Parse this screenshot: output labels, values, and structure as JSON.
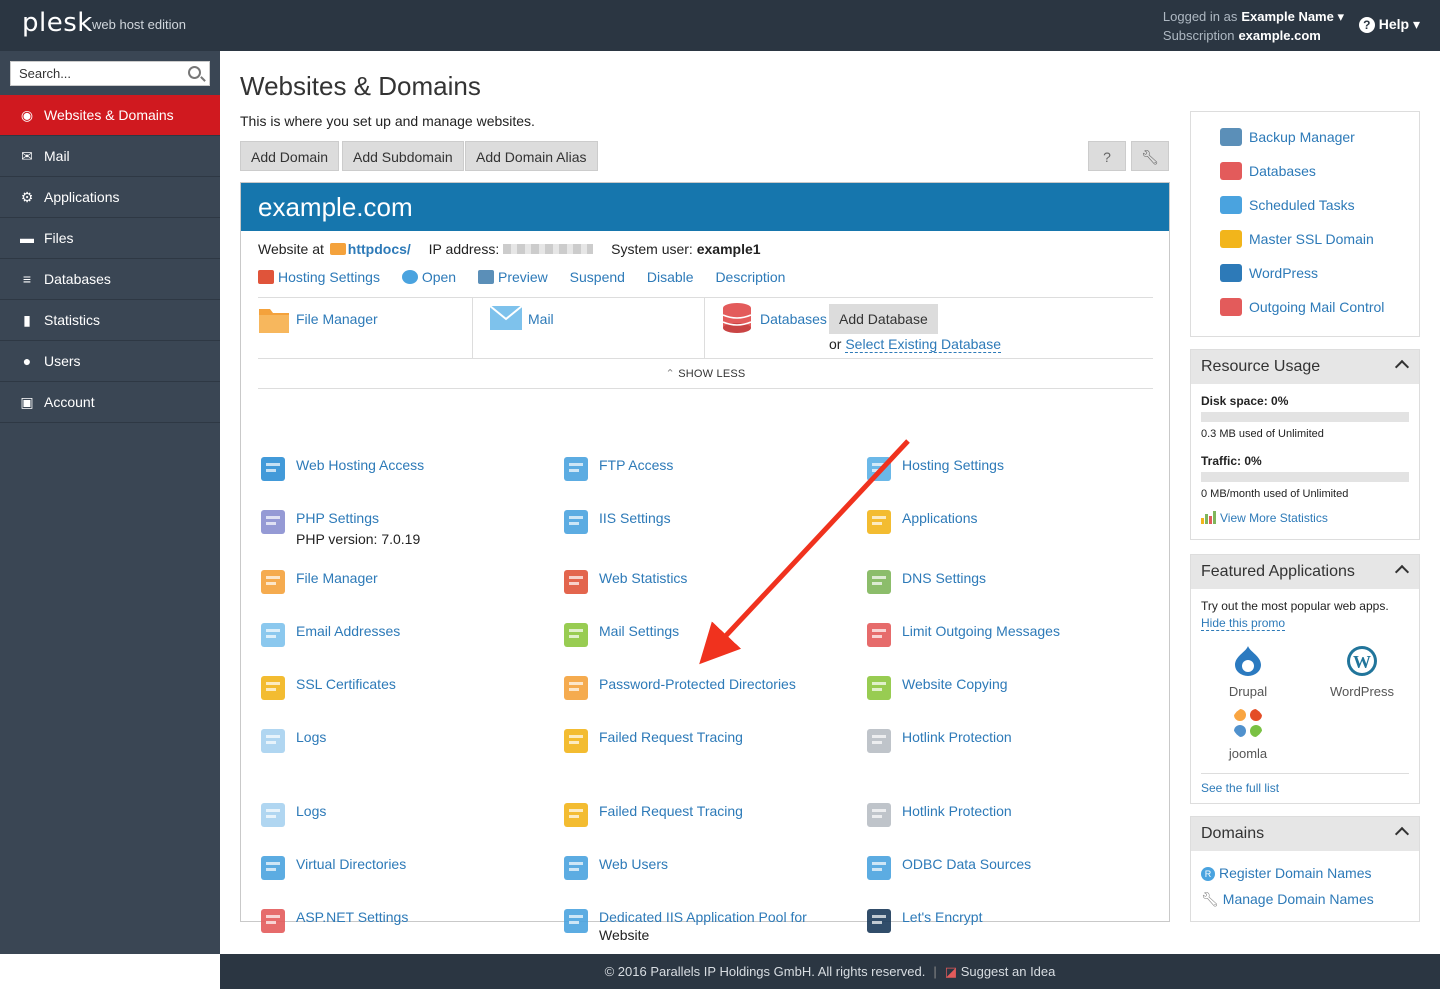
{
  "topbar": {
    "logo": "plesk",
    "edition": "web host edition",
    "logged_in_label": "Logged in as",
    "user_name": "Example Name",
    "subscription_label": "Subscription",
    "subscription_value": "example.com",
    "help": "Help"
  },
  "sidebar": {
    "search_placeholder": "Search...",
    "items": [
      {
        "label": "Websites & Domains",
        "icon": "globe-icon",
        "active": true
      },
      {
        "label": "Mail",
        "icon": "envelope-icon"
      },
      {
        "label": "Applications",
        "icon": "gear-icon"
      },
      {
        "label": "Files",
        "icon": "folder-icon"
      },
      {
        "label": "Databases",
        "icon": "database-icon"
      },
      {
        "label": "Statistics",
        "icon": "bar-chart-icon"
      },
      {
        "label": "Users",
        "icon": "user-icon"
      },
      {
        "label": "Account",
        "icon": "account-icon"
      }
    ]
  },
  "main": {
    "title": "Websites & Domains",
    "subtitle": "This is where you set up and manage websites.",
    "buttons": [
      "Add Domain",
      "Add Subdomain",
      "Add Domain Alias"
    ],
    "help_btn": "?",
    "domain": {
      "name": "example.com",
      "website_at_label": "Website at",
      "docroot": "httpdocs/",
      "ip_label": "IP address:",
      "system_user_label": "System user:",
      "system_user": "example1",
      "links": [
        "Hosting Settings",
        "Open",
        "Preview",
        "Suspend",
        "Disable",
        "Description"
      ],
      "quick": {
        "file_manager": "File Manager",
        "mail": "Mail",
        "databases": "Databases",
        "add_database": "Add Database",
        "or": "or",
        "select_existing": "Select Existing Database"
      },
      "show_less": "SHOW LESS",
      "grid": [
        {
          "label": "Web Hosting Access",
          "icon": "web-hosting-access-icon",
          "color": "#2d8fd5"
        },
        {
          "label": "FTP Access",
          "icon": "ftp-access-icon",
          "color": "#4aa3df"
        },
        {
          "label": "Hosting Settings",
          "icon": "hosting-settings-icon",
          "color": "#5bb0e6"
        },
        {
          "label": "PHP Settings",
          "icon": "php-icon",
          "color": "#8a8fd0",
          "sub": "PHP version: 7.0.19"
        },
        {
          "label": "IIS Settings",
          "icon": "iis-settings-icon",
          "color": "#4aa3df"
        },
        {
          "label": "Applications",
          "icon": "applications-gear-icon",
          "color": "#f2b51b"
        },
        {
          "label": "File Manager",
          "icon": "folder-icon",
          "color": "#f4a23c"
        },
        {
          "label": "Web Statistics",
          "icon": "web-statistics-icon",
          "color": "#e0543a"
        },
        {
          "label": "DNS Settings",
          "icon": "dns-settings-icon",
          "color": "#7fb65b"
        },
        {
          "label": "Email Addresses",
          "icon": "envelope-icon",
          "color": "#7ec2ec"
        },
        {
          "label": "Mail Settings",
          "icon": "mail-settings-icon",
          "color": "#8dc63f"
        },
        {
          "label": "Limit Outgoing Messages",
          "icon": "limit-mail-icon",
          "color": "#e35b5b"
        },
        {
          "label": "SSL Certificates",
          "icon": "ssl-certificate-icon",
          "color": "#f2b51b"
        },
        {
          "label": "Password-Protected Directories",
          "icon": "protected-folder-icon",
          "color": "#f4a23c"
        },
        {
          "label": "Website Copying",
          "icon": "website-copying-icon",
          "color": "#8dc63f"
        },
        {
          "label": "Logs",
          "icon": "logs-icon",
          "color": "#a7d2f0"
        },
        {
          "label": "Failed Request Tracing",
          "icon": "failed-request-tracing-icon",
          "color": "#f2b51b"
        },
        {
          "label": "Hotlink Protection",
          "icon": "hotlink-protection-icon",
          "color": "#b8bec4"
        },
        {
          "label": "Logs",
          "icon": "logs-icon",
          "color": "#a7d2f0"
        },
        {
          "label": "Failed Request Tracing",
          "icon": "failed-request-tracing-icon",
          "color": "#f2b51b"
        },
        {
          "label": "Hotlink Protection",
          "icon": "hotlink-protection-icon",
          "color": "#b8bec4"
        },
        {
          "label": "Virtual Directories",
          "icon": "virtual-directories-icon",
          "color": "#4aa3df"
        },
        {
          "label": "Web Users",
          "icon": "web-users-icon",
          "color": "#4aa3df"
        },
        {
          "label": "ODBC Data Sources",
          "icon": "odbc-icon",
          "color": "#4aa3df"
        },
        {
          "label": "ASP.NET Settings",
          "icon": "aspnet-icon",
          "color": "#e35b5b"
        },
        {
          "label": "Dedicated IIS Application Pool for",
          "label2": "Website",
          "icon": "app-pool-icon",
          "color": "#4aa3df"
        },
        {
          "label": "Let's Encrypt",
          "icon": "lets-encrypt-icon",
          "color": "#1b3a5a"
        }
      ]
    }
  },
  "right": {
    "tools": [
      {
        "label": "Backup Manager",
        "icon": "backup-icon",
        "color": "#5b8fb8"
      },
      {
        "label": "Databases",
        "icon": "database-icon",
        "color": "#e35b5b"
      },
      {
        "label": "Scheduled Tasks",
        "icon": "calendar-icon",
        "color": "#4aa3df"
      },
      {
        "label": "Master SSL Domain",
        "icon": "lock-icon",
        "color": "#f2b51b"
      },
      {
        "label": "WordPress",
        "icon": "wordpress-icon",
        "color": "#2d7ab8"
      },
      {
        "label": "Outgoing Mail Control",
        "icon": "mail-control-icon",
        "color": "#e35b5b"
      }
    ],
    "resource": {
      "title": "Resource Usage",
      "disk_label": "Disk space: 0%",
      "disk_fraction": 0,
      "disk_note": "0.3 MB used of Unlimited",
      "traffic_label": "Traffic: 0%",
      "traffic_fraction": 0,
      "traffic_note": "0 MB/month used of Unlimited",
      "more_stats": "View More Statistics"
    },
    "featured": {
      "title": "Featured Applications",
      "text": "Try out the most popular web apps.",
      "hide": "Hide this promo",
      "apps": [
        {
          "label": "Drupal",
          "icon": "drupal-icon",
          "color": "#2b7ac0"
        },
        {
          "label": "WordPress",
          "icon": "wordpress-icon",
          "color": "#21759b"
        },
        {
          "label": "joomla",
          "icon": "joomla-icon",
          "color": "#e44d26"
        }
      ],
      "see_all": "See the full list"
    },
    "domains": {
      "title": "Domains",
      "register": "Register Domain Names",
      "manage": "Manage Domain Names"
    }
  },
  "footer": {
    "copyright": "© 2016 Parallels IP Holdings GmbH. All rights reserved.",
    "suggest": "Suggest an Idea"
  }
}
